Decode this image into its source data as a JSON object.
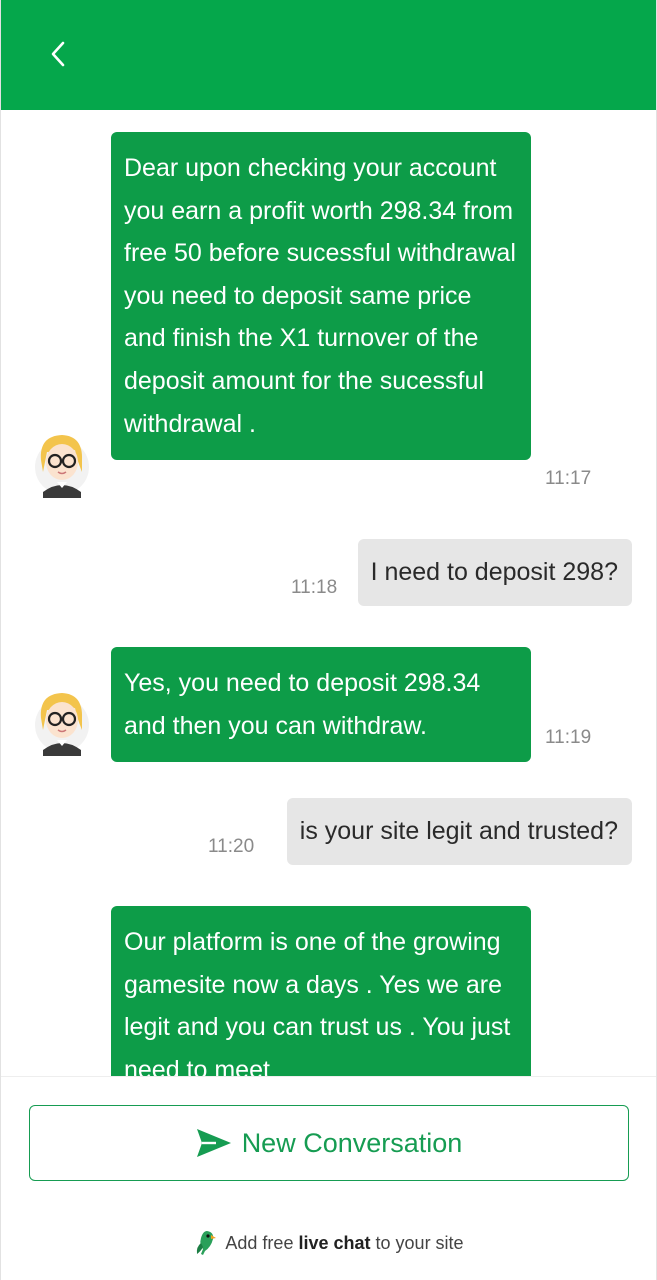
{
  "header": {
    "back_icon": "chevron-left-icon"
  },
  "messages": [
    {
      "sender": "agent",
      "text": "Dear upon checking your account you earn a profit worth 298.34 from free 50 before sucessful withdrawal you need to deposit same price and finish the X1 turnover of the deposit amount for the sucessful withdrawal .",
      "time": "11:17"
    },
    {
      "sender": "user",
      "text": "I need to deposit 298?",
      "time": "11:18"
    },
    {
      "sender": "agent",
      "text": "Yes, you need to deposit 298.34 and then you can withdraw.",
      "time": "11:19"
    },
    {
      "sender": "user",
      "text": "is your site legit and trusted?",
      "time": "11:20"
    },
    {
      "sender": "agent",
      "text": "Our platform is one of the growing gamesite now a days . Yes we are legit and you can trust us . You just need to meet",
      "time": ""
    }
  ],
  "footer": {
    "new_conversation_label": "New Conversation",
    "send_icon": "send-icon",
    "powered_prefix": "Add free",
    "powered_bold": "live chat",
    "powered_suffix": "to your site",
    "logo_icon": "parrot-logo-icon"
  },
  "colors": {
    "header": "#05a74b",
    "agent_bubble": "#0d9c48",
    "user_bubble": "#e6e6e6",
    "accent": "#169c52"
  }
}
